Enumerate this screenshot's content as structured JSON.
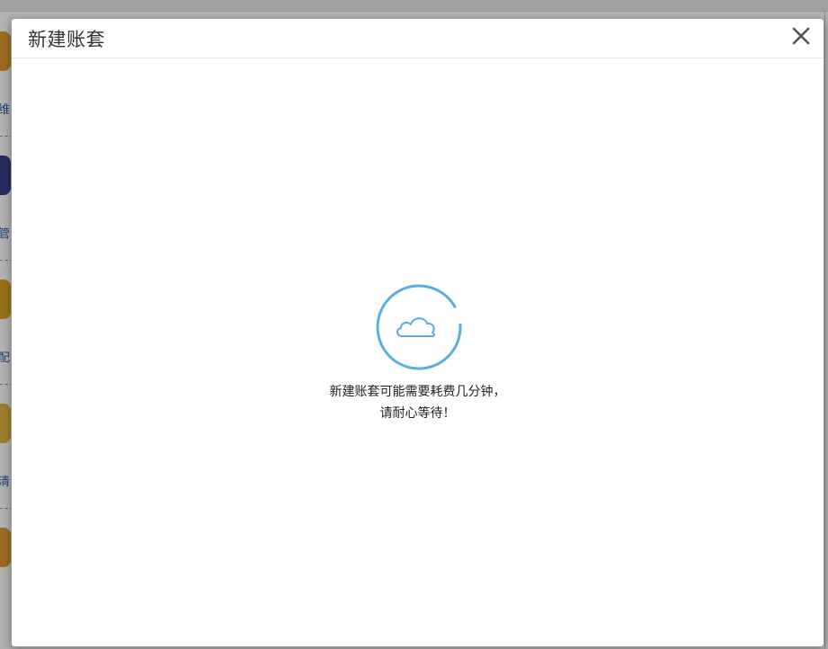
{
  "background": {
    "sidebar_items": [
      {
        "label": "维",
        "icon": "tools-icon",
        "color": "#e39b2f"
      },
      {
        "label": "管",
        "icon": "people-icon",
        "color": "#3c3f8f"
      },
      {
        "label": "配",
        "icon": "gear-icon",
        "color": "#d9a21c"
      },
      {
        "label": "清",
        "icon": "clean-icon",
        "color": "#e2b540"
      },
      {
        "label": "",
        "icon": "wrench-icon",
        "color": "#e39b2f"
      }
    ]
  },
  "modal": {
    "title": "新建账套",
    "close_icon": "close-icon",
    "loading": {
      "icon": "cloud-icon",
      "spinner_color": "#5aaee0",
      "line1": "新建账套可能需要耗费几分钟，",
      "line2": "请耐心等待！"
    }
  }
}
